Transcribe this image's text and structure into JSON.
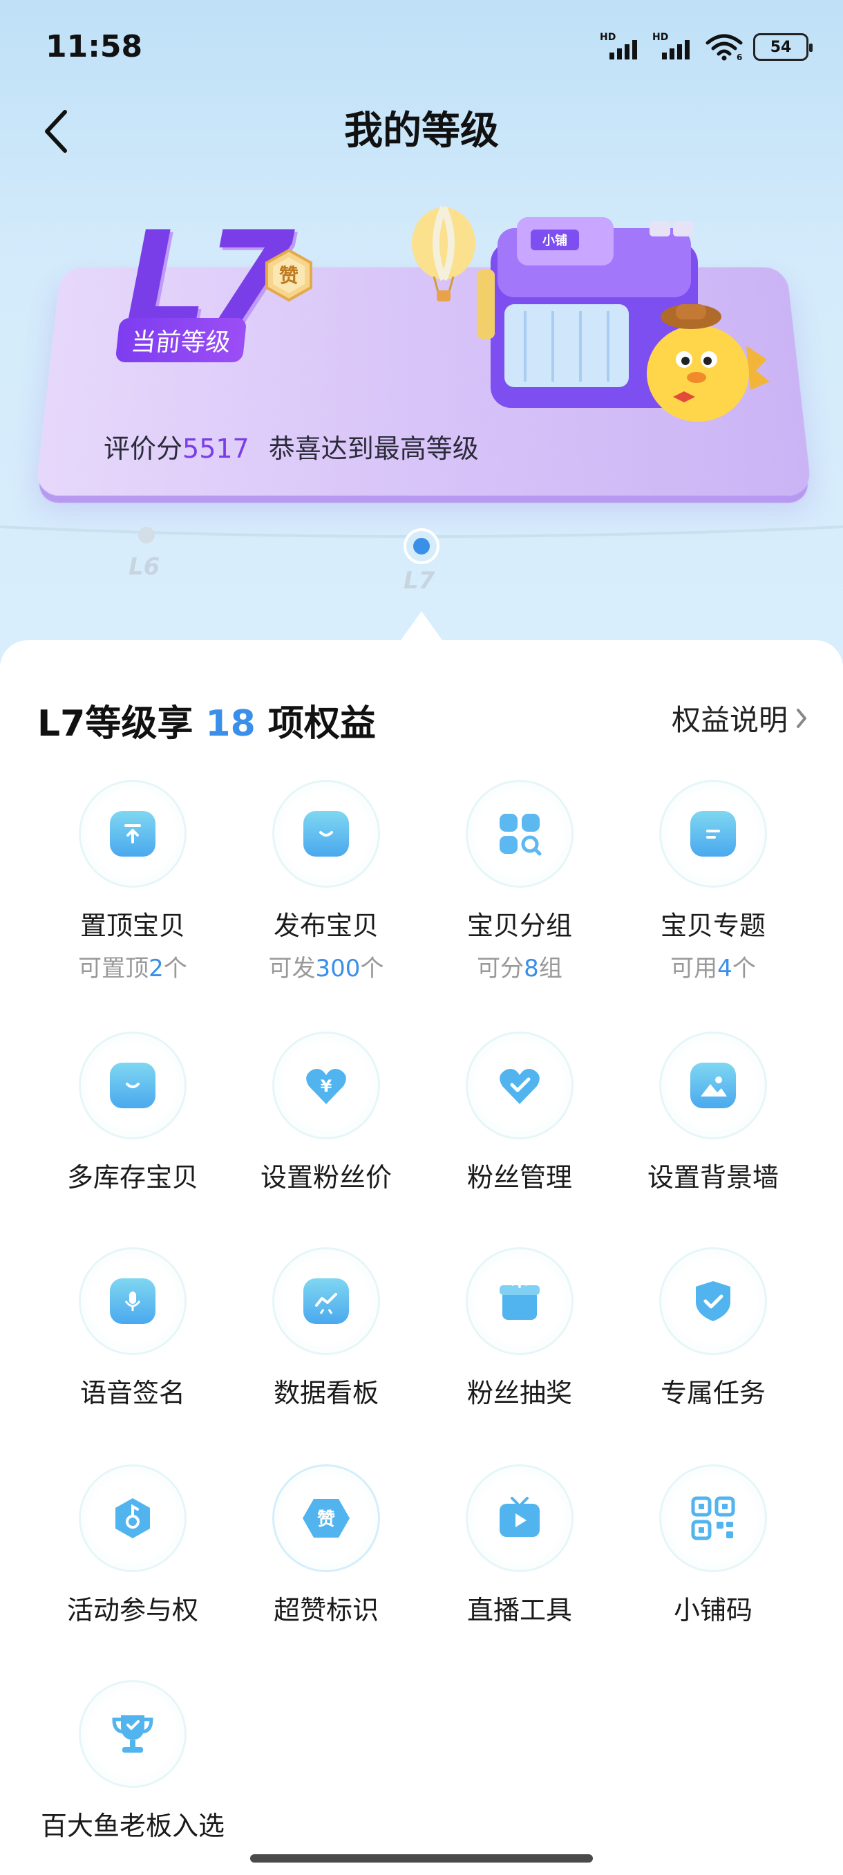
{
  "status_bar": {
    "time": "11:58",
    "signal1": "HD",
    "signal2": "HD",
    "wifi_suffix": "6",
    "battery": "54"
  },
  "header": {
    "title": "我的等级",
    "back_icon": "chevron-left-icon"
  },
  "level_card": {
    "level": "L7",
    "badge": "赞",
    "current_tag": "当前等级",
    "score_label": "评价分",
    "score_value": "5517",
    "message": "恭喜达到最高等级",
    "illustration_shop_sign": "小铺",
    "accent_color": "#7a3ee8"
  },
  "track": {
    "levels": [
      "L6",
      "L7"
    ],
    "current": "L7"
  },
  "benefits": {
    "title_prefix": "L7等级享 ",
    "count": "18",
    "title_suffix": " 项权益",
    "explain_label": "权益说明",
    "items": [
      {
        "label": "置顶宝贝",
        "sub_pre": "可置顶",
        "sub_num": "2",
        "sub_post": "个",
        "icon": "pin-top-icon"
      },
      {
        "label": "发布宝贝",
        "sub_pre": "可发",
        "sub_num": "300",
        "sub_post": "个",
        "icon": "shopping-bag-icon"
      },
      {
        "label": "宝贝分组",
        "sub_pre": "可分",
        "sub_num": "8",
        "sub_post": "组",
        "icon": "group-search-icon"
      },
      {
        "label": "宝贝专题",
        "sub_pre": "可用",
        "sub_num": "4",
        "sub_post": "个",
        "icon": "topic-doc-icon"
      },
      {
        "label": "多库存宝贝",
        "icon": "multi-bag-icon"
      },
      {
        "label": "设置粉丝价",
        "icon": "heart-yen-icon"
      },
      {
        "label": "粉丝管理",
        "icon": "heart-check-icon"
      },
      {
        "label": "设置背景墙",
        "icon": "image-icon"
      },
      {
        "label": "语音签名",
        "icon": "microphone-icon"
      },
      {
        "label": "数据看板",
        "icon": "chart-board-icon"
      },
      {
        "label": "粉丝抽奖",
        "icon": "gift-box-icon"
      },
      {
        "label": "专属任务",
        "icon": "shield-check-icon"
      },
      {
        "label": "活动参与权",
        "icon": "hexagon-key-icon"
      },
      {
        "label": "超赞标识",
        "icon": "zan-hexagon-icon",
        "icon_text": "赞"
      },
      {
        "label": "直播工具",
        "icon": "tv-play-icon"
      },
      {
        "label": "小铺码",
        "icon": "qr-code-icon"
      },
      {
        "label": "百大鱼老板入选",
        "icon": "trophy-icon"
      }
    ]
  },
  "colors": {
    "highlight": "#3a8fe8",
    "icon_gradient_top": "#7fd7f0",
    "icon_gradient_bottom": "#4aa8ef"
  }
}
